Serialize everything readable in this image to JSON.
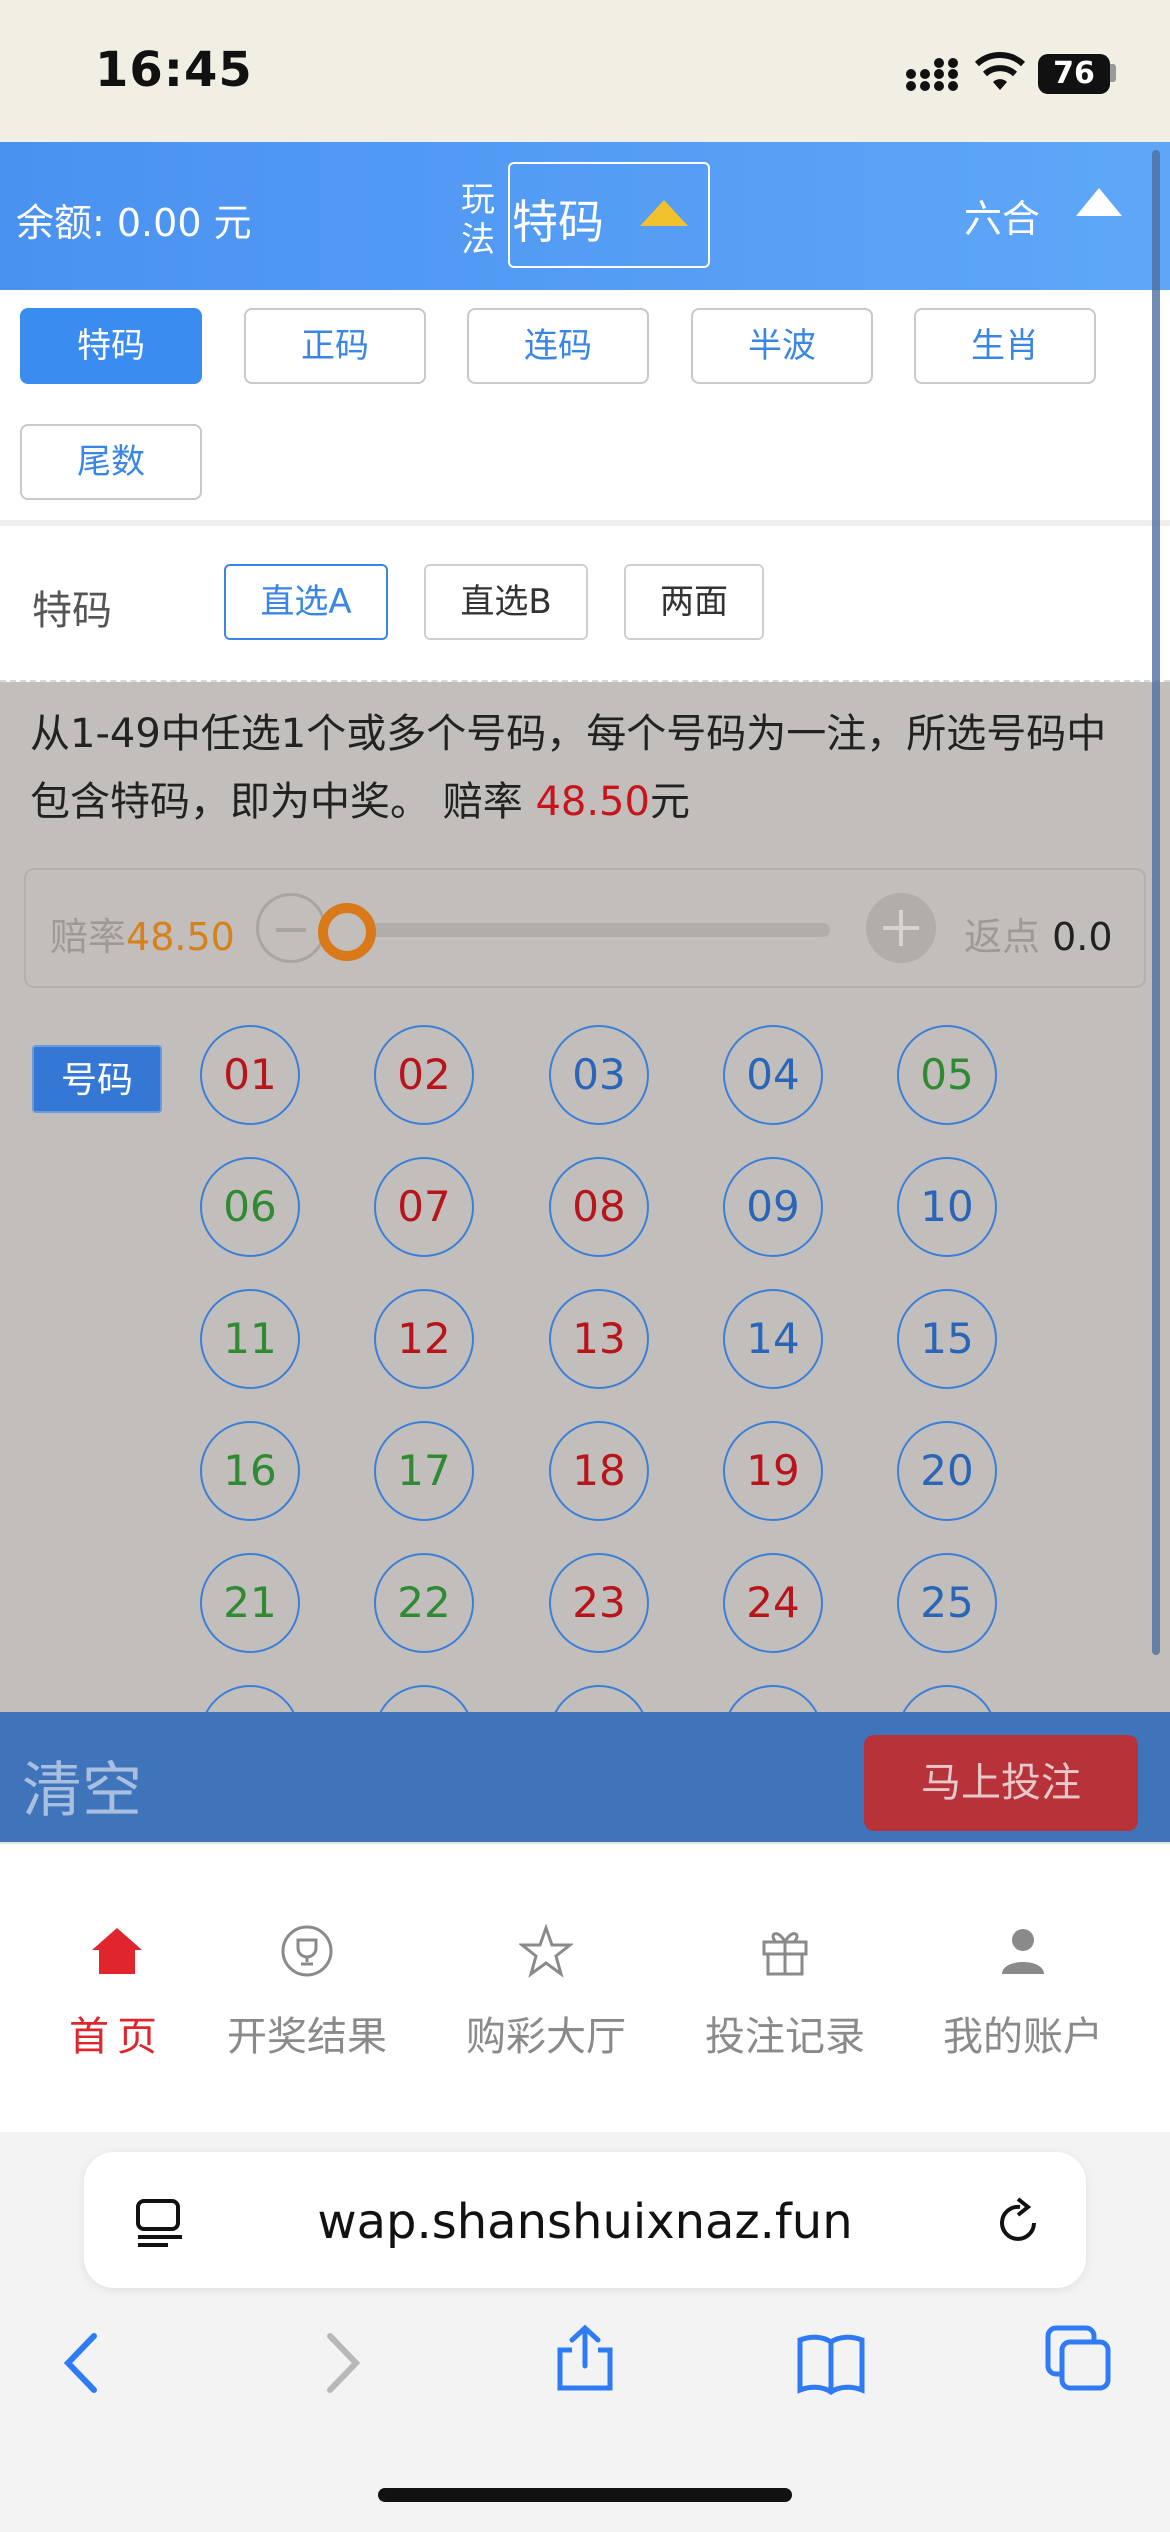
{
  "status_bar": {
    "time": "16:45",
    "battery": "76"
  },
  "header": {
    "balance": "余额: 0.00 元",
    "play_label": "玩法",
    "play_selected": "特码",
    "lottery_name": "六合"
  },
  "tabs": [
    {
      "label": "特码",
      "active": true
    },
    {
      "label": "正码",
      "active": false
    },
    {
      "label": "连码",
      "active": false
    },
    {
      "label": "半波",
      "active": false
    },
    {
      "label": "生肖",
      "active": false
    },
    {
      "label": "尾数",
      "active": false
    }
  ],
  "subtype": {
    "label": "特码",
    "options": [
      {
        "label": "直选A",
        "active": true
      },
      {
        "label": "直选B",
        "active": false
      },
      {
        "label": "两面",
        "active": false
      }
    ]
  },
  "description": {
    "text_before": "从1-49中任选1个或多个号码，每个号码为一注，所选号码中包含特码，即为中奖。 赔率 ",
    "odds": "48.50",
    "unit": "元"
  },
  "slider": {
    "odds_label": "赔率",
    "odds_value": "48.50",
    "rebate_label": "返点",
    "rebate_value": "0.0"
  },
  "numbers": {
    "label": "号码",
    "balls": [
      {
        "n": "01",
        "color": "red"
      },
      {
        "n": "02",
        "color": "red"
      },
      {
        "n": "03",
        "color": "blue"
      },
      {
        "n": "04",
        "color": "blue"
      },
      {
        "n": "05",
        "color": "green"
      },
      {
        "n": "06",
        "color": "green"
      },
      {
        "n": "07",
        "color": "red"
      },
      {
        "n": "08",
        "color": "red"
      },
      {
        "n": "09",
        "color": "blue"
      },
      {
        "n": "10",
        "color": "blue"
      },
      {
        "n": "11",
        "color": "green"
      },
      {
        "n": "12",
        "color": "red"
      },
      {
        "n": "13",
        "color": "red"
      },
      {
        "n": "14",
        "color": "blue"
      },
      {
        "n": "15",
        "color": "blue"
      },
      {
        "n": "16",
        "color": "green"
      },
      {
        "n": "17",
        "color": "green"
      },
      {
        "n": "18",
        "color": "red"
      },
      {
        "n": "19",
        "color": "red"
      },
      {
        "n": "20",
        "color": "blue"
      },
      {
        "n": "21",
        "color": "green"
      },
      {
        "n": "22",
        "color": "green"
      },
      {
        "n": "23",
        "color": "red"
      },
      {
        "n": "24",
        "color": "red"
      },
      {
        "n": "25",
        "color": "blue"
      }
    ]
  },
  "action_bar": {
    "clear": "清空",
    "bet": "马上投注"
  },
  "bottom_nav": [
    {
      "label": "首页",
      "icon": "home-icon",
      "active": true
    },
    {
      "label": "开奖结果",
      "icon": "trophy-icon",
      "active": false
    },
    {
      "label": "购彩大厅",
      "icon": "star-icon",
      "active": false
    },
    {
      "label": "投注记录",
      "icon": "gift-icon",
      "active": false
    },
    {
      "label": "我的账户",
      "icon": "user-icon",
      "active": false
    }
  ],
  "browser": {
    "url": "wap.shanshuixnaz.fun"
  },
  "colors": {
    "header_blue": "#4a92f0",
    "accent_blue": "#3a8cf0",
    "ball_red": "#b8141b",
    "ball_blue": "#2a65b8",
    "ball_green": "#2f8a33",
    "bet_red": "#b8323a",
    "nav_active": "#e0262c"
  }
}
